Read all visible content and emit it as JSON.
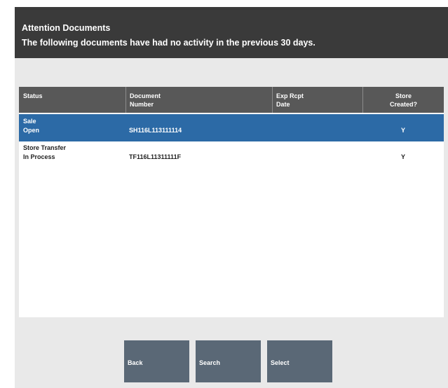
{
  "header": {
    "title": "Attention Documents",
    "subtitle": "The following documents have had no activity in the previous 30 days."
  },
  "table": {
    "columns": [
      {
        "line1": "Status",
        "line2": ""
      },
      {
        "line1": "Document",
        "line2": "Number"
      },
      {
        "line1": "Exp Rcpt",
        "line2": "Date"
      },
      {
        "line1": "Store",
        "line2": "Created?"
      }
    ],
    "rows": [
      {
        "status_line1": "Sale",
        "status_line2": "Open",
        "document_number": "SH116L113111114",
        "exp_rcpt_date": "",
        "store_created": "Y",
        "selected": true
      },
      {
        "status_line1": "Store Transfer",
        "status_line2": "In Process",
        "document_number": "TF116L11311111F",
        "exp_rcpt_date": "",
        "store_created": "Y",
        "selected": false
      }
    ]
  },
  "buttons": {
    "back": "Back",
    "search": "Search",
    "select": "Select"
  },
  "colors": {
    "header_bg": "#3a3a3a",
    "table_header_bg": "#585858",
    "selected_row_bg": "#2c6aa6",
    "button_bg": "#5a6876",
    "frame_bg": "#e9e9e9"
  }
}
